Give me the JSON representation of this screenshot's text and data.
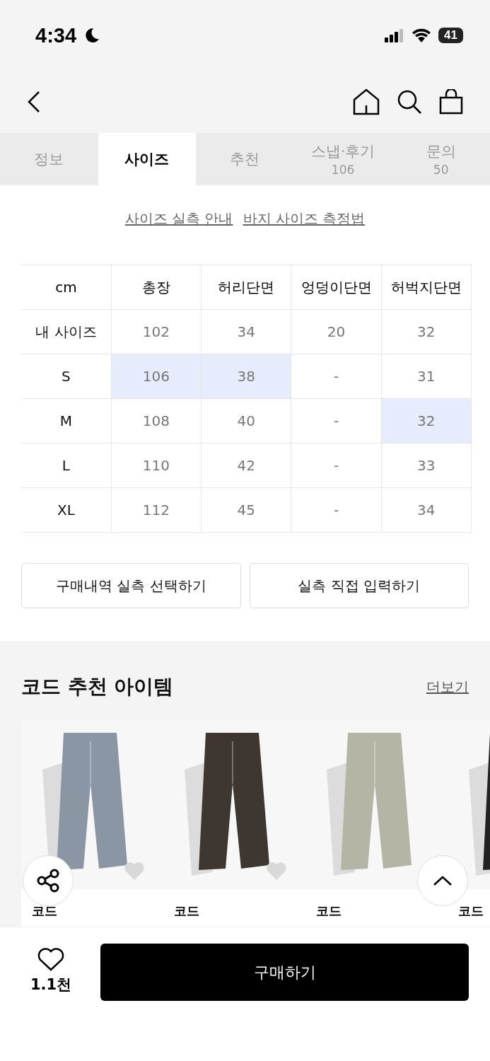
{
  "status_bar": {
    "time": "4:34",
    "battery": "41"
  },
  "tabs": [
    {
      "label": "정보",
      "selected": false
    },
    {
      "label": "사이즈",
      "selected": true
    },
    {
      "label": "추천",
      "selected": false
    },
    {
      "label": "스냅·후기",
      "count": "106",
      "selected": false
    },
    {
      "label": "문의",
      "count": "50",
      "selected": false
    }
  ],
  "guide_links": [
    "사이즈 실측 안내",
    "바지 사이즈 측정법"
  ],
  "size_table": {
    "columns": [
      "cm",
      "총장",
      "허리단면",
      "엉덩이단면",
      "허벅지단면"
    ],
    "rows": [
      {
        "cells": [
          {
            "value": "내 사이즈",
            "highlighted": false
          },
          {
            "value": "102",
            "highlighted": false
          },
          {
            "value": "34",
            "highlighted": false
          },
          {
            "value": "20",
            "highlighted": false
          },
          {
            "value": "32",
            "highlighted": false
          }
        ]
      },
      {
        "cells": [
          {
            "value": "S",
            "highlighted": false
          },
          {
            "value": "106",
            "highlighted": true
          },
          {
            "value": "38",
            "highlighted": true
          },
          {
            "value": "-",
            "highlighted": false
          },
          {
            "value": "31",
            "highlighted": false
          }
        ]
      },
      {
        "cells": [
          {
            "value": "M",
            "highlighted": false
          },
          {
            "value": "108",
            "highlighted": false
          },
          {
            "value": "40",
            "highlighted": false
          },
          {
            "value": "-",
            "highlighted": false
          },
          {
            "value": "32",
            "highlighted": true
          }
        ]
      },
      {
        "cells": [
          {
            "value": "L",
            "highlighted": false
          },
          {
            "value": "110",
            "highlighted": false
          },
          {
            "value": "42",
            "highlighted": false
          },
          {
            "value": "-",
            "highlighted": false
          },
          {
            "value": "33",
            "highlighted": false
          }
        ]
      },
      {
        "cells": [
          {
            "value": "XL",
            "highlighted": false
          },
          {
            "value": "112",
            "highlighted": false
          },
          {
            "value": "45",
            "highlighted": false
          },
          {
            "value": "-",
            "highlighted": false
          },
          {
            "value": "34",
            "highlighted": false
          }
        ]
      }
    ]
  },
  "size_buttons": [
    "구매내역 실측 선택하기",
    "실측 직접 입력하기"
  ],
  "recommendations": {
    "title": "코드 추천 아이템",
    "more": "더보기",
    "items": [
      {
        "brand": "코드",
        "show_heart": true
      },
      {
        "brand": "코드",
        "show_heart": true
      },
      {
        "brand": "코드",
        "show_heart": false
      },
      {
        "brand": "코드",
        "show_heart": false
      }
    ]
  },
  "bottom_bar": {
    "likes": "1.1천",
    "buy": "구매하기"
  }
}
